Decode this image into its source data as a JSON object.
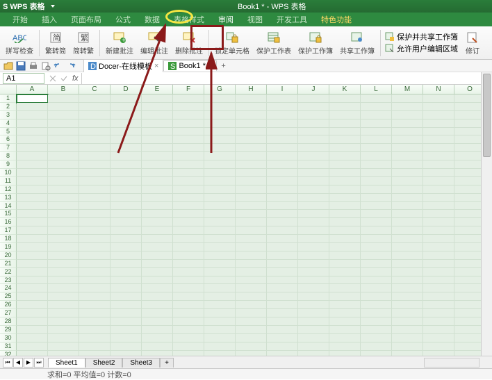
{
  "title_app": "S WPS 表格",
  "title_doc": "Book1 * - WPS 表格",
  "menu": [
    "开始",
    "插入",
    "页面布局",
    "公式",
    "数据",
    "表格样式",
    "审阅",
    "视图",
    "开发工具",
    "特色功能"
  ],
  "menu_active_index": 6,
  "ribbon": {
    "spellcheck": "拼写检查",
    "s2t": "繁转简",
    "t2s": "简转繁",
    "new_comment": "新建批注",
    "edit_comment": "编辑批注",
    "delete_comment": "删除批注",
    "lock_cell": "锁定单元格",
    "protect_sheet": "保护工作表",
    "protect_book": "保护工作簿",
    "share_book": "共享工作簿",
    "protect_share": "保护并共享工作簿",
    "allow_edit": "允许用户编辑区域",
    "revise": "修订"
  },
  "doctabs": {
    "t1": "Docer-在线模板",
    "t2": "Book1 *"
  },
  "name_box": "A1",
  "columns": [
    "A",
    "B",
    "C",
    "D",
    "E",
    "F",
    "G",
    "H",
    "I",
    "J",
    "K",
    "L",
    "M",
    "N",
    "O"
  ],
  "row_count": 32,
  "sheets": {
    "s1": "Sheet1",
    "s2": "Sheet2",
    "s3": "Sheet3"
  },
  "status_text": "求和=0  平均值=0  计数=0"
}
